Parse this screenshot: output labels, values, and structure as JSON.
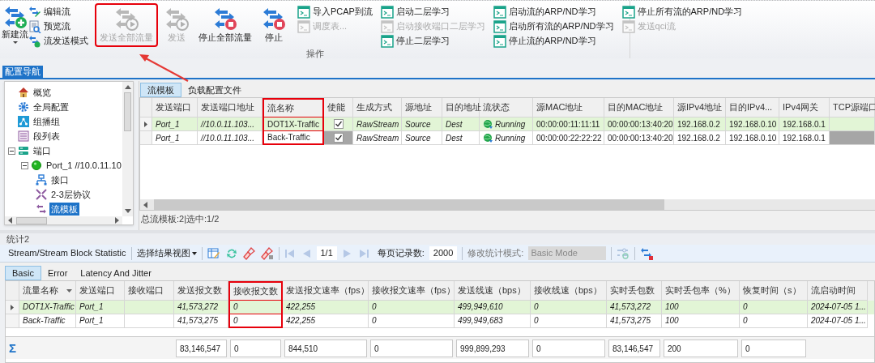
{
  "ribbon": {
    "new_button": {
      "label": "新建流",
      "dropdown": true
    },
    "stream_items": [
      {
        "kind": "edit",
        "label": "编辑流"
      },
      {
        "kind": "preview",
        "label": "预览流"
      },
      {
        "kind": "mode",
        "label": "流发送模式"
      }
    ],
    "action_buttons": [
      {
        "kind": "send",
        "label": "发送全部流量",
        "disabled": true,
        "highlighted": true
      },
      {
        "kind": "send",
        "label": "发送",
        "disabled": true,
        "highlighted": false
      },
      {
        "kind": "stop",
        "label": "停止全部流量",
        "disabled": false,
        "highlighted": false
      },
      {
        "kind": "stop",
        "label": "停止",
        "disabled": false,
        "highlighted": false
      }
    ],
    "command_columns": [
      [
        {
          "label": "导入PCAP到流",
          "disabled": false
        },
        {
          "label": "调度表...",
          "disabled": true
        }
      ],
      [
        {
          "label": "启动二层学习",
          "disabled": false
        },
        {
          "label": "启动接收端口二层学习",
          "disabled": true
        },
        {
          "label": "停止二层学习",
          "disabled": false
        }
      ],
      [
        {
          "label": "启动流的ARP/ND学习",
          "disabled": false
        },
        {
          "label": "启动所有流的ARP/ND学习",
          "disabled": false
        },
        {
          "label": "停止流的ARP/ND学习",
          "disabled": false
        }
      ],
      [
        {
          "label": "停止所有流的ARP/ND学习",
          "disabled": false
        },
        {
          "label": "发送qci流",
          "disabled": true
        }
      ]
    ],
    "group_label": "操作"
  },
  "nav": {
    "title": "配置导航",
    "tree": [
      {
        "kind": "home",
        "label": "概览",
        "selected": false
      },
      {
        "kind": "gear",
        "label": "全局配置",
        "selected": false
      },
      {
        "kind": "multicast",
        "label": "组播组",
        "selected": false
      },
      {
        "kind": "list",
        "label": "段列表",
        "selected": false
      },
      {
        "kind": "port",
        "label": "端口",
        "selected": false,
        "expanded": true,
        "children": [
          {
            "kind": "status",
            "label": "Port_1 //10.0.11.10",
            "selected": false,
            "expanded": true,
            "children": [
              {
                "kind": "interface",
                "label": "接口",
                "selected": false
              },
              {
                "kind": "protocol",
                "label": "2-3层协议",
                "selected": false
              },
              {
                "kind": "stream",
                "label": "流模板",
                "selected": true
              }
            ]
          }
        ]
      }
    ]
  },
  "stream_tabs": [
    {
      "label": "流模板",
      "selected": true
    },
    {
      "label": "负载配置文件",
      "selected": false
    }
  ],
  "stream_table": {
    "columns": [
      {
        "label": "发送端口",
        "kind": "text",
        "highlighted": false
      },
      {
        "label": "发送端口地址",
        "kind": "text",
        "highlighted": false
      },
      {
        "label": "流名称",
        "kind": "text",
        "highlighted": true
      },
      {
        "label": "使能",
        "kind": "check",
        "highlighted": false
      },
      {
        "label": "生成方式",
        "kind": "text",
        "highlighted": false
      },
      {
        "label": "源地址",
        "kind": "text",
        "highlighted": false
      },
      {
        "label": "目的地址",
        "kind": "text",
        "highlighted": false
      },
      {
        "label": "流状态",
        "kind": "status",
        "highlighted": false
      },
      {
        "label": "源MAC地址",
        "kind": "text",
        "highlighted": false
      },
      {
        "label": "目的MAC地址",
        "kind": "text",
        "highlighted": false
      },
      {
        "label": "源IPv4地址",
        "kind": "text",
        "highlighted": false
      },
      {
        "label": "目的IPv4...",
        "kind": "text",
        "highlighted": false
      },
      {
        "label": "IPv4网关",
        "kind": "text",
        "highlighted": false
      },
      {
        "label": "TCP源端口",
        "kind": "blank",
        "highlighted": false
      }
    ],
    "rows": [
      {
        "selected": true,
        "checked": true,
        "check_cell_shaded": false,
        "blank_cell_shaded": false,
        "cells": [
          "Port_1",
          "//10.0.11.103...",
          "DOT1X-Traffic",
          "",
          "RawStream",
          "Source",
          "Dest",
          "Running",
          "00:00:00:11:11:11",
          "00:00:00:13:40:20",
          "192.168.0.2",
          "192.168.0.10",
          "192.168.0.1",
          ""
        ]
      },
      {
        "selected": false,
        "checked": true,
        "check_cell_shaded": true,
        "blank_cell_shaded": true,
        "cells": [
          "Port_1",
          "//10.0.11.103...",
          "Back-Traffic",
          "",
          "RawStream",
          "Source",
          "Dest",
          "Running",
          "00:00:00:22:22:22",
          "00:00:00:13:40:20",
          "192.168.0.2",
          "192.168.0.10",
          "192.168.0.1",
          ""
        ]
      }
    ],
    "status": "总流模板:2|选中:1/2"
  },
  "stats": {
    "title": "统计2",
    "toolbar": {
      "view_label": "Stream/Stream Block Statistic",
      "view_menu": "选择结果视图",
      "page": "1/1",
      "page_size_label": "每页记录数:",
      "page_size": "2000",
      "mode_label": "修改统计模式:",
      "mode_value": "Basic Mode"
    },
    "tabs": [
      {
        "label": "Basic",
        "selected": true
      },
      {
        "label": "Error",
        "selected": false
      },
      {
        "label": "Latency And Jitter",
        "selected": false
      }
    ],
    "columns": [
      {
        "label": "流量名称",
        "kind": "text",
        "sortable": true,
        "highlighted": false
      },
      {
        "label": "发送端口",
        "kind": "text",
        "highlighted": false
      },
      {
        "label": "接收端口",
        "kind": "blank",
        "highlighted": false
      },
      {
        "label": "发送报文数",
        "kind": "text",
        "highlighted": false,
        "has_total": true
      },
      {
        "label": "接收报文数",
        "kind": "text",
        "highlighted": true,
        "has_total": true
      },
      {
        "label": "发送报文速率（fps）",
        "kind": "text",
        "highlighted": false,
        "has_total": true
      },
      {
        "label": "接收报文速率（fps）",
        "kind": "text",
        "highlighted": false,
        "has_total": true
      },
      {
        "label": "发送线速（bps）",
        "kind": "text",
        "highlighted": false,
        "has_total": true
      },
      {
        "label": "接收线速（bps）",
        "kind": "text",
        "highlighted": false,
        "has_total": true
      },
      {
        "label": "实时丢包数",
        "kind": "text",
        "highlighted": false,
        "has_total": true
      },
      {
        "label": "实时丢包率（%）",
        "kind": "text",
        "highlighted": false,
        "has_total": true
      },
      {
        "label": "恢复时间（s）",
        "kind": "text",
        "highlighted": false,
        "has_total": true
      },
      {
        "label": "流启动时间",
        "kind": "text",
        "highlighted": false
      }
    ],
    "rows": [
      {
        "selected": true,
        "cells": [
          "DOT1X-Traffic",
          "Port_1",
          "",
          "41,573,272",
          "0",
          "422,255",
          "0",
          "499,949,610",
          "0",
          "41,573,272",
          "100",
          "0",
          "2024-07-05 1..."
        ]
      },
      {
        "selected": false,
        "cells": [
          "Back-Traffic",
          "Port_1",
          "",
          "41,573,275",
          "0",
          "422,255",
          "0",
          "499,949,683",
          "0",
          "41,573,275",
          "100",
          "0",
          "2024-07-05 1..."
        ]
      }
    ],
    "sum_symbol": "Σ",
    "totals": [
      "83,146,547",
      "0",
      "844,510",
      "0",
      "999,899,293",
      "0",
      "83,146,547",
      "200",
      "0"
    ]
  }
}
